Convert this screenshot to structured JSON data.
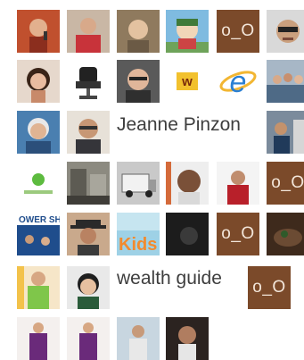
{
  "placeholder_text": "o_O",
  "names": {
    "jeanne": "Jeanne Pinzon",
    "wealth": "wealth guide"
  },
  "tile_texts": {
    "w_logo": "w",
    "ie_logo": "e",
    "kids": "Kids",
    "power": "OWER SH"
  },
  "colors": {
    "placeholder_bg": "#7b4a2a",
    "placeholder_fg": "#f3e6da",
    "name_text": "#3e3e3e"
  }
}
